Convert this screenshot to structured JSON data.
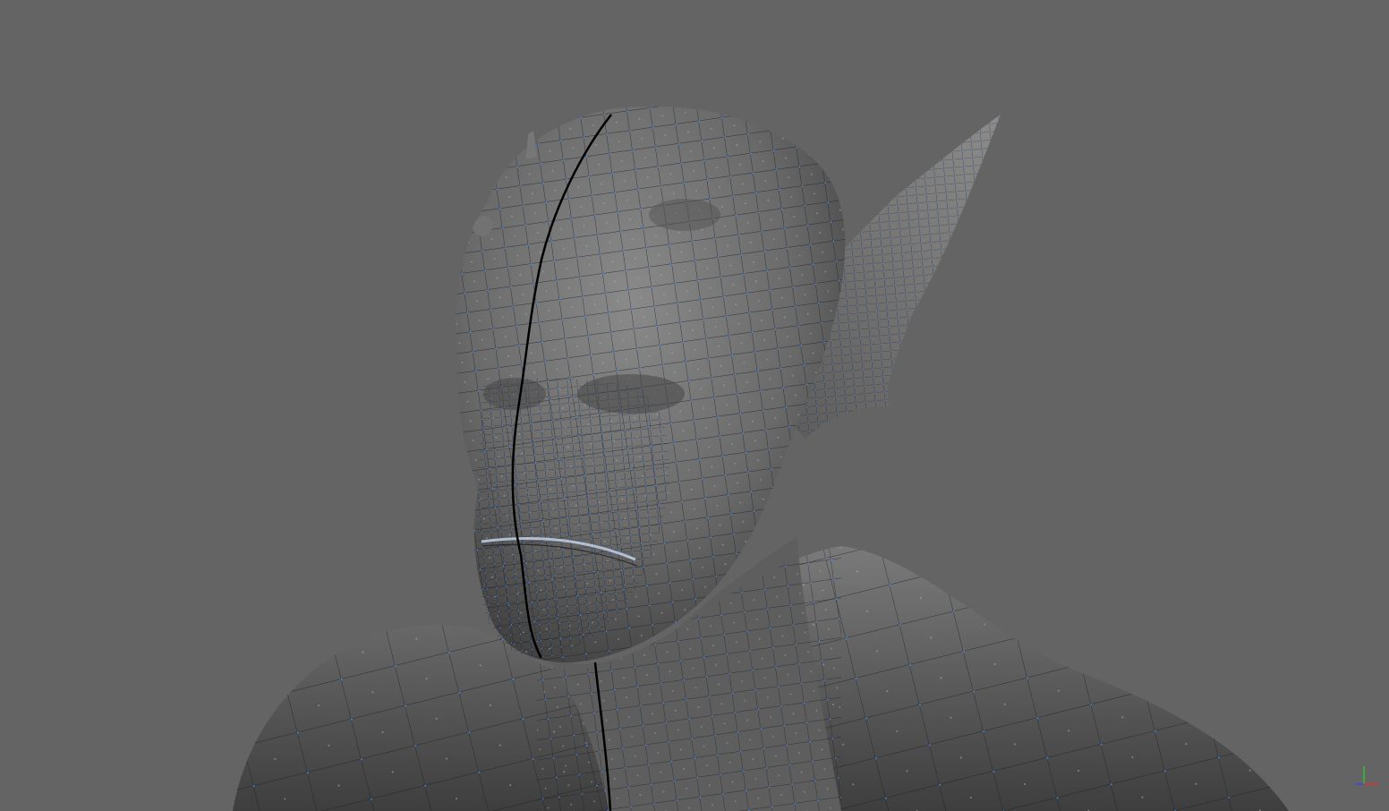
{
  "viewport": {
    "background_color": "#646464",
    "display_mode": "wireframe-on-shaded",
    "model": "sculpted-creature-head-bust",
    "mesh_surface_color": "#6f6f6f",
    "wire_color": "#1a1a1a",
    "vertex_color": "#3a8cff",
    "seam_color": "#000000"
  },
  "axis_gizmo": {
    "x_color": "#e03030",
    "y_color": "#30c030",
    "z_color": "#3050e0"
  }
}
